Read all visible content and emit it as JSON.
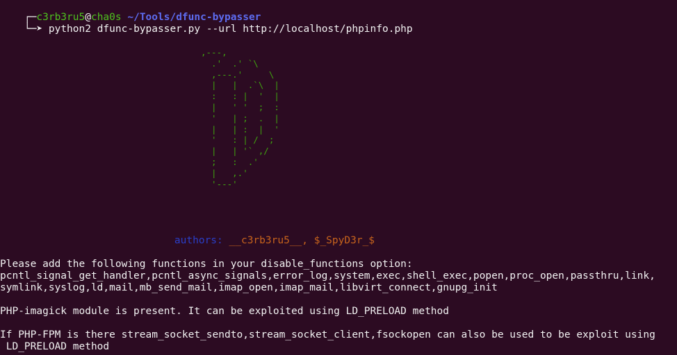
{
  "prompt": {
    "corner_top": "┌─",
    "corner_bottom": "└─➤",
    "user": "c3rb3ru5",
    "at": "@",
    "host": "cha0s",
    "path": "~/Tools/dfunc-bypasser",
    "command": "python2 dfunc-bypasser.py --url http://localhost/phpinfo.php"
  },
  "ascii_art": ",---,\n  .'  .' `\\\n  ,---.'     \\\n  |   |  .`\\  |\n  :   : |  '  |\n  |   ' '  ;  :\n  '   | ;  .  |\n  |   | :  |  '\n  '   : | /  ;\n  |   | '` ,/\n  ;   :  .'\n  |   ,.'\n  '---'",
  "authors": {
    "label": "authors:",
    "names": "__c3rb3ru5__, $_SpyD3r_$"
  },
  "output": {
    "line1": "Please add the following functions in your disable_functions option:",
    "line2": "pcntl_signal_get_handler,pcntl_async_signals,error_log,system,exec,shell_exec,popen,proc_open,passthru,link,",
    "line3": "symlink,syslog,ld,mail,mb_send_mail,imap_open,imap_mail,libvirt_connect,gnupg_init",
    "line4": "PHP-imagick module is present. It can be exploited using LD_PRELOAD method",
    "line5": "If PHP-FPM is there stream_socket_sendto,stream_socket_client,fsockopen can also be used to be exploit using",
    "line6": " LD_PRELOAD method"
  },
  "colors": {
    "background": "#2c0b22",
    "prompt_user": "#4ec21e",
    "prompt_path": "#5d6cf0",
    "ascii_art": "#3fa30f",
    "authors_label": "#2a3fc9",
    "authors_names": "#c8641c",
    "text": "#f2f2f2"
  }
}
